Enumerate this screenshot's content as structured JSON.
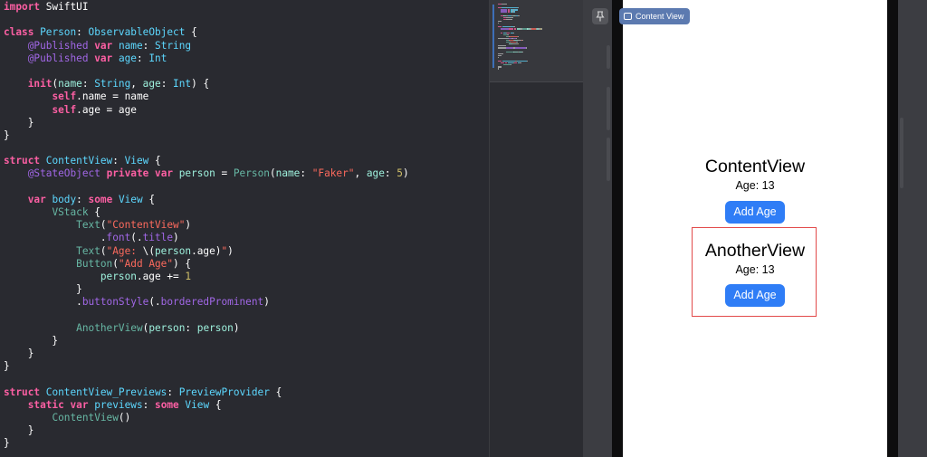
{
  "editor": {
    "lines": [
      [
        [
          "kw",
          "import"
        ],
        [
          "pl",
          " SwiftUI"
        ]
      ],
      [],
      [
        [
          "kw",
          "class"
        ],
        [
          "pl",
          " "
        ],
        [
          "ty",
          "Person"
        ],
        [
          "pl",
          ": "
        ],
        [
          "ty",
          "ObservableObject"
        ],
        [
          "pl",
          " {"
        ]
      ],
      [
        [
          "pl",
          "    "
        ],
        [
          "at",
          "@Published"
        ],
        [
          "pl",
          " "
        ],
        [
          "kw",
          "var"
        ],
        [
          "pl",
          " "
        ],
        [
          "ty",
          "name"
        ],
        [
          "pl",
          ": "
        ],
        [
          "ty",
          "String"
        ]
      ],
      [
        [
          "pl",
          "    "
        ],
        [
          "at",
          "@Published"
        ],
        [
          "pl",
          " "
        ],
        [
          "kw",
          "var"
        ],
        [
          "pl",
          " "
        ],
        [
          "ty",
          "age"
        ],
        [
          "pl",
          ": "
        ],
        [
          "ty",
          "Int"
        ]
      ],
      [],
      [
        [
          "pl",
          "    "
        ],
        [
          "kw",
          "init"
        ],
        [
          "pl",
          "("
        ],
        [
          "ref",
          "name"
        ],
        [
          "pl",
          ": "
        ],
        [
          "ty",
          "String"
        ],
        [
          "pl",
          ", "
        ],
        [
          "ref",
          "age"
        ],
        [
          "pl",
          ": "
        ],
        [
          "ty",
          "Int"
        ],
        [
          "pl",
          ") {"
        ]
      ],
      [
        [
          "pl",
          "        "
        ],
        [
          "kw",
          "self"
        ],
        [
          "pl",
          ".name = name"
        ]
      ],
      [
        [
          "pl",
          "        "
        ],
        [
          "kw",
          "self"
        ],
        [
          "pl",
          ".age = age"
        ]
      ],
      [
        [
          "pl",
          "    }"
        ]
      ],
      [
        [
          "pl",
          "}"
        ]
      ],
      [],
      [
        [
          "kw",
          "struct"
        ],
        [
          "pl",
          " "
        ],
        [
          "ty",
          "ContentView"
        ],
        [
          "pl",
          ": "
        ],
        [
          "ty",
          "View"
        ],
        [
          "pl",
          " {"
        ]
      ],
      [
        [
          "pl",
          "    "
        ],
        [
          "at",
          "@StateObject"
        ],
        [
          "pl",
          " "
        ],
        [
          "kw",
          "private"
        ],
        [
          "pl",
          " "
        ],
        [
          "kw",
          "var"
        ],
        [
          "pl",
          " "
        ],
        [
          "ref",
          "person"
        ],
        [
          "pl",
          " = "
        ],
        [
          "fn",
          "Person"
        ],
        [
          "pl",
          "("
        ],
        [
          "ref",
          "name"
        ],
        [
          "pl",
          ": "
        ],
        [
          "st",
          "\"Faker\""
        ],
        [
          "pl",
          ", "
        ],
        [
          "ref",
          "age"
        ],
        [
          "pl",
          ": "
        ],
        [
          "nu",
          "5"
        ],
        [
          "pl",
          ")"
        ]
      ],
      [],
      [
        [
          "pl",
          "    "
        ],
        [
          "kw",
          "var"
        ],
        [
          "pl",
          " "
        ],
        [
          "ty",
          "body"
        ],
        [
          "pl",
          ": "
        ],
        [
          "kw",
          "some"
        ],
        [
          "pl",
          " "
        ],
        [
          "ty",
          "View"
        ],
        [
          "pl",
          " {"
        ]
      ],
      [
        [
          "pl",
          "        "
        ],
        [
          "fn",
          "VStack"
        ],
        [
          "pl",
          " {"
        ]
      ],
      [
        [
          "pl",
          "            "
        ],
        [
          "fn",
          "Text"
        ],
        [
          "pl",
          "("
        ],
        [
          "st",
          "\"ContentView\""
        ],
        [
          "pl",
          ")"
        ]
      ],
      [
        [
          "pl",
          "                ."
        ],
        [
          "md",
          "font"
        ],
        [
          "pl",
          "(."
        ],
        [
          "md",
          "title"
        ],
        [
          "pl",
          ")"
        ]
      ],
      [
        [
          "pl",
          "            "
        ],
        [
          "fn",
          "Text"
        ],
        [
          "pl",
          "("
        ],
        [
          "st",
          "\"Age: "
        ],
        [
          "pl",
          "\\("
        ],
        [
          "ref",
          "person"
        ],
        [
          "pl",
          ".age)"
        ],
        [
          "st",
          "\""
        ],
        [
          "pl",
          ")"
        ]
      ],
      [
        [
          "pl",
          "            "
        ],
        [
          "fn",
          "Button"
        ],
        [
          "pl",
          "("
        ],
        [
          "st",
          "\"Add Age\""
        ],
        [
          "pl",
          ") {"
        ]
      ],
      [
        [
          "pl",
          "                "
        ],
        [
          "ref",
          "person"
        ],
        [
          "pl",
          ".age += "
        ],
        [
          "nu",
          "1"
        ]
      ],
      [
        [
          "pl",
          "            }"
        ]
      ],
      [
        [
          "pl",
          "            ."
        ],
        [
          "md",
          "buttonStyle"
        ],
        [
          "pl",
          "(."
        ],
        [
          "md",
          "borderedProminent"
        ],
        [
          "pl",
          ")"
        ]
      ],
      [],
      [
        [
          "pl",
          "            "
        ],
        [
          "fn",
          "AnotherView"
        ],
        [
          "pl",
          "("
        ],
        [
          "ref",
          "person"
        ],
        [
          "pl",
          ": "
        ],
        [
          "ref",
          "person"
        ],
        [
          "pl",
          ")"
        ]
      ],
      [
        [
          "pl",
          "        }"
        ]
      ],
      [
        [
          "pl",
          "    }"
        ]
      ],
      [
        [
          "pl",
          "}"
        ]
      ],
      [],
      [
        [
          "kw",
          "struct"
        ],
        [
          "pl",
          " "
        ],
        [
          "ty",
          "ContentView_Previews"
        ],
        [
          "pl",
          ": "
        ],
        [
          "ty",
          "PreviewProvider"
        ],
        [
          "pl",
          " {"
        ]
      ],
      [
        [
          "pl",
          "    "
        ],
        [
          "kw",
          "static"
        ],
        [
          "pl",
          " "
        ],
        [
          "kw",
          "var"
        ],
        [
          "pl",
          " "
        ],
        [
          "ty",
          "previews"
        ],
        [
          "pl",
          ": "
        ],
        [
          "kw",
          "some"
        ],
        [
          "pl",
          " "
        ],
        [
          "ty",
          "View"
        ],
        [
          "pl",
          " {"
        ]
      ],
      [
        [
          "pl",
          "        "
        ],
        [
          "fn",
          "ContentView"
        ],
        [
          "pl",
          "()"
        ]
      ],
      [
        [
          "pl",
          "    }"
        ]
      ],
      [
        [
          "pl",
          "}"
        ]
      ]
    ]
  },
  "canvas": {
    "pin_icon": "pin-icon",
    "preview_tab_label": "Content View",
    "content_view": {
      "title": "ContentView",
      "age_text": "Age: 13",
      "button_label": "Add Age"
    },
    "another_view": {
      "title": "AnotherView",
      "age_text": "Age: 13",
      "button_label": "Add Age",
      "outline_color": "#e24a4a"
    },
    "accent_color": "#2f7df6"
  },
  "syntax_colors": {
    "keyword": "#fc5fa3",
    "type": "#5dd8ff",
    "function": "#67b7a4",
    "string": "#fc6a5d",
    "number": "#d0bf69",
    "attribute": "#a167e6"
  }
}
